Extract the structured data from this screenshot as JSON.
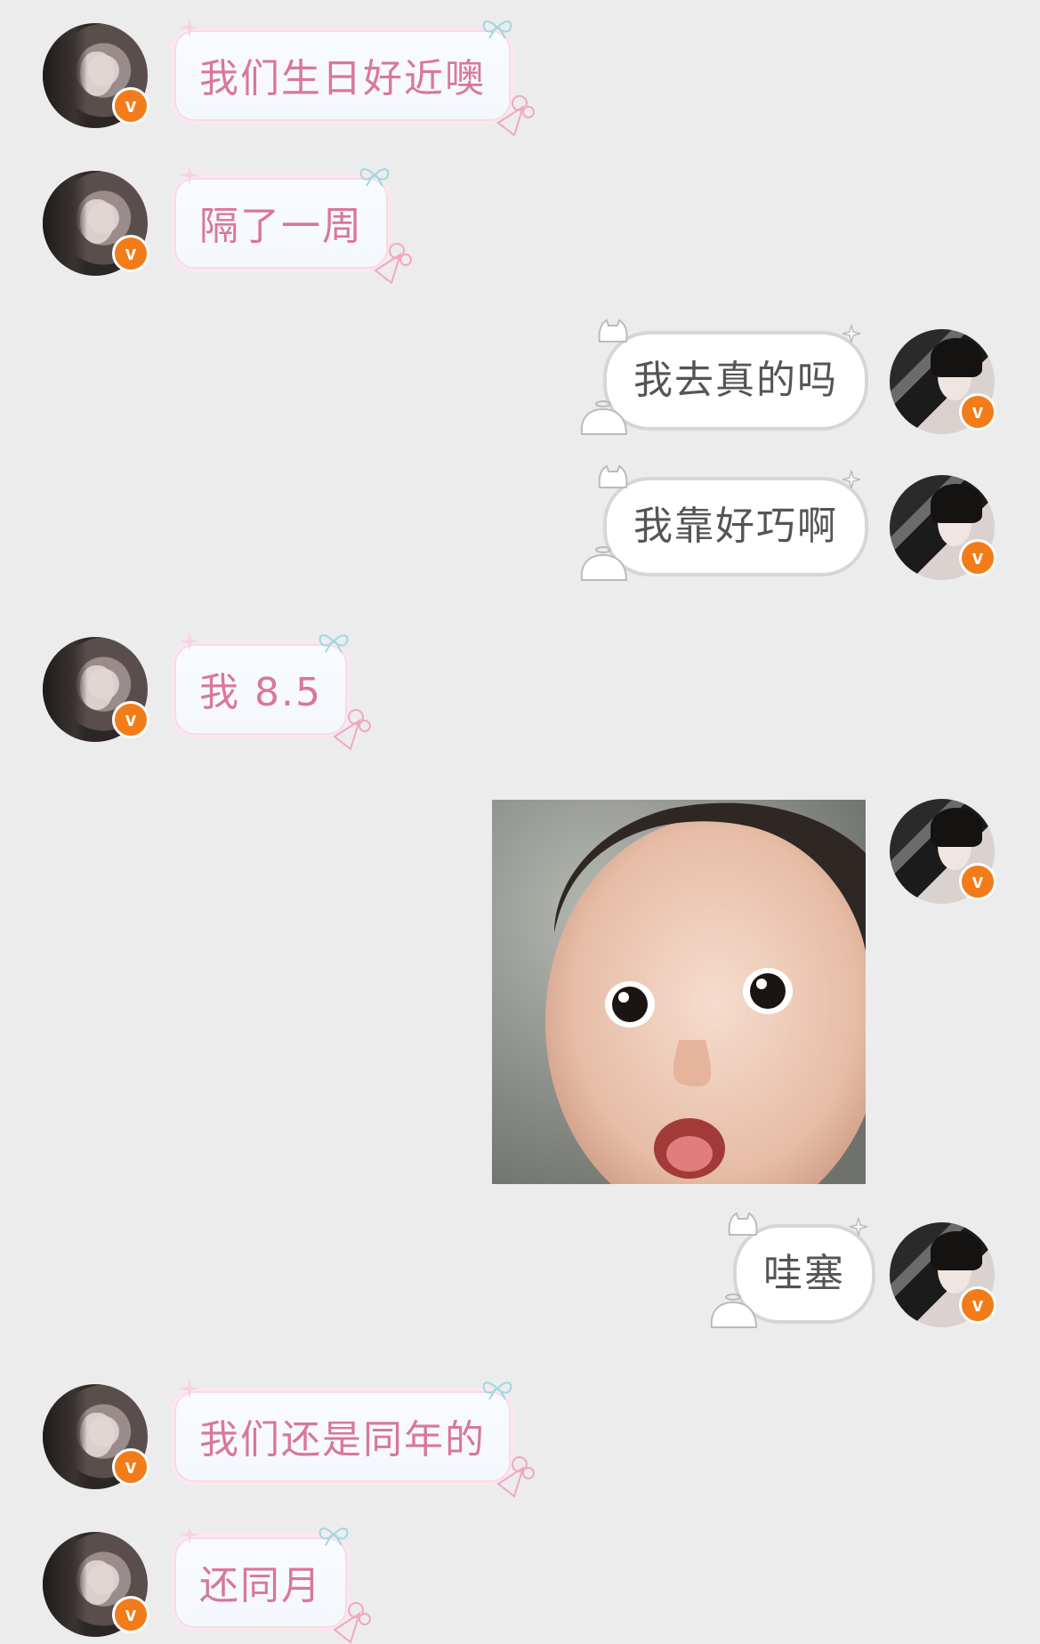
{
  "conversation": {
    "messages": [
      {
        "side": "in",
        "text": "我们生日好近噢"
      },
      {
        "side": "in",
        "text": "隔了一周"
      },
      {
        "side": "out",
        "text": "我去真的吗"
      },
      {
        "side": "out",
        "text": "我靠好巧啊"
      },
      {
        "side": "in",
        "text": "我 8.5"
      },
      {
        "side": "out",
        "type": "sticker",
        "sticker": "surprised-baby-face"
      },
      {
        "side": "out",
        "text": "哇塞"
      },
      {
        "side": "in",
        "text": "我们还是同年的"
      },
      {
        "side": "in",
        "text": "还同月"
      }
    ],
    "badge_label": "v"
  },
  "colors": {
    "background": "#ececec",
    "incoming_text": "#d9779b",
    "outgoing_text": "#555555",
    "verified_badge": "#f27c1a"
  }
}
